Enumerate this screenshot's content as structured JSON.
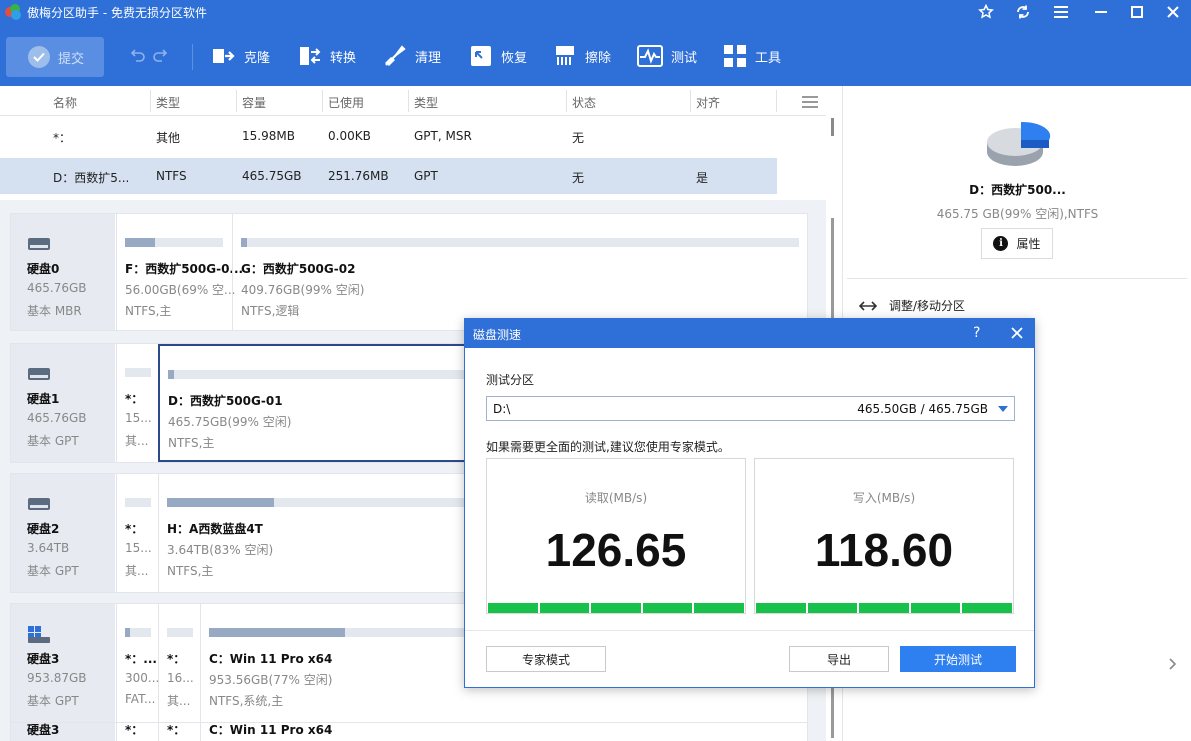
{
  "app": {
    "title": "傲梅分区助手 - 免费无损分区软件"
  },
  "colors": {
    "accent": "#2e6fd8",
    "progress": "#18c14a",
    "selected_row": "#d5e0f0"
  },
  "toolbar": {
    "submit_label": "提交",
    "tools": [
      {
        "label": "克隆",
        "icon": "clone-icon"
      },
      {
        "label": "转换",
        "icon": "convert-icon"
      },
      {
        "label": "清理",
        "icon": "cleanup-icon"
      },
      {
        "label": "恢复",
        "icon": "recover-icon"
      },
      {
        "label": "擦除",
        "icon": "wipe-icon"
      },
      {
        "label": "测试",
        "icon": "test-icon"
      },
      {
        "label": "工具",
        "icon": "tools-icon"
      }
    ]
  },
  "table": {
    "headers": [
      "名称",
      "类型",
      "容量",
      "已使用",
      "类型",
      "状态",
      "对齐"
    ],
    "rows": [
      {
        "name": "*：",
        "type": "其他",
        "capacity": "15.98MB",
        "used": "0.00KB",
        "ptype": "GPT, MSR",
        "status": "无",
        "align": ""
      },
      {
        "name": "D：西数扩5...",
        "type": "NTFS",
        "capacity": "465.75GB",
        "used": "251.76MB",
        "ptype": "GPT",
        "status": "无",
        "align": "是"
      }
    ]
  },
  "disks": [
    {
      "name": "硬盘0",
      "size": "465.76GB",
      "type": "基本 MBR",
      "parts": [
        {
          "name": "F：西数扩500G-0...",
          "size": "56.00GB(69% 空...",
          "fs": "NTFS,主",
          "used_fraction": 0.31
        },
        {
          "name": "G：西数扩500G-02",
          "size": "409.76GB(99% 空闲)",
          "fs": "NTFS,逻辑",
          "used_fraction": 0.01
        }
      ]
    },
    {
      "name": "硬盘1",
      "size": "465.76GB",
      "type": "基本 GPT",
      "parts": [
        {
          "name": "*：",
          "size": "15...",
          "fs": "其...",
          "used_fraction": 0
        },
        {
          "name": "D：西数扩500G-01",
          "size": "465.75GB(99% 空闲)",
          "fs": "NTFS,主",
          "used_fraction": 0.01
        }
      ]
    },
    {
      "name": "硬盘2",
      "size": "3.64TB",
      "type": "基本 GPT",
      "parts": [
        {
          "name": "*：",
          "size": "15...",
          "fs": "其...",
          "used_fraction": 0
        },
        {
          "name": "H：A西数蓝盘4T",
          "size": "3.64TB(83% 空闲)",
          "fs": "NTFS,主",
          "used_fraction": 0.17
        }
      ]
    },
    {
      "name": "硬盘3",
      "size": "953.87GB",
      "type": "基本 GPT",
      "parts": [
        {
          "name": "*：...",
          "size": "300...",
          "fs": "FAT...",
          "used_fraction": 0.2
        },
        {
          "name": "*：",
          "size": "16...",
          "fs": "其...",
          "used_fraction": 0
        },
        {
          "name": "C：Win 11 Pro x64",
          "size": "953.56GB(77% 空闲)",
          "fs": "NTFS,系统,主",
          "used_fraction": 0.23
        }
      ]
    },
    {
      "name": "硬盘3",
      "size": "",
      "type": "",
      "parts": [
        {
          "name": "*：",
          "size": "",
          "fs": "",
          "used_fraction": 0
        },
        {
          "name": "*：",
          "size": "",
          "fs": "",
          "used_fraction": 0
        },
        {
          "name": "C：Win 11 Pro x64",
          "size": "",
          "fs": "",
          "used_fraction": 0
        }
      ]
    }
  ],
  "rpanel": {
    "name": "D：西数扩500...",
    "size": "465.75 GB(99% 空闲),NTFS",
    "properties_label": "属性",
    "operation": "调整/移动分区"
  },
  "dialog": {
    "title": "磁盘测速",
    "help": "?",
    "partition_label": "测试分区",
    "partition_value": "D:\\",
    "partition_size": "465.50GB / 465.75GB",
    "hint": "如果需要更全面的测试,建议您使用专家模式。",
    "read_label": "读取(MB/s)",
    "read_value": "126.65",
    "read_progress": 1.0,
    "write_label": "写入(MB/s)",
    "write_value": "118.60",
    "write_progress": 1.0,
    "expert_button": "专家模式",
    "export_button": "导出",
    "start_button": "开始测试"
  }
}
